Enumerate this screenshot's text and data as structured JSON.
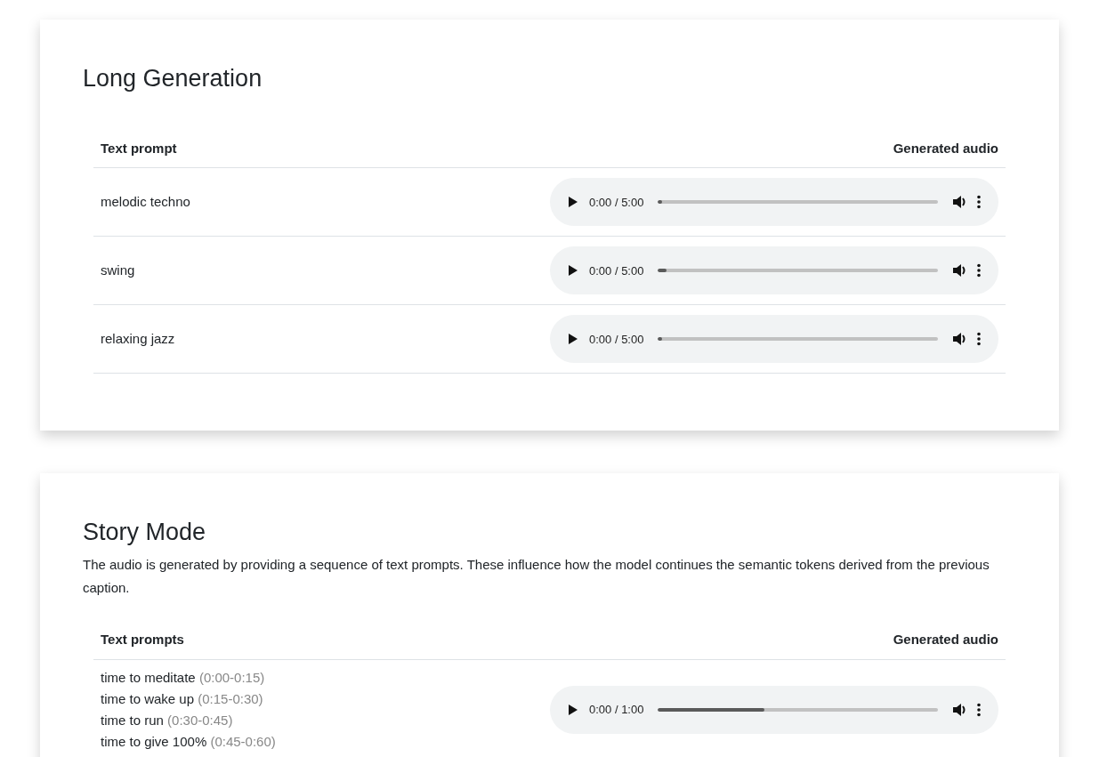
{
  "sections": [
    {
      "title": "Long Generation",
      "columns": [
        "Text prompt",
        "Generated audio"
      ],
      "rows": [
        {
          "prompts": [
            {
              "text": "melodic techno"
            }
          ],
          "audio": {
            "time": "0:00 / 5:00",
            "level": 0.01
          }
        },
        {
          "prompts": [
            {
              "text": "swing"
            }
          ],
          "audio": {
            "time": "0:00 / 5:00",
            "level": 0.03
          }
        },
        {
          "prompts": [
            {
              "text": "relaxing jazz"
            }
          ],
          "audio": {
            "time": "0:00 / 5:00",
            "level": 0.01
          }
        }
      ]
    },
    {
      "title": "Story Mode",
      "description": "The audio is generated by providing a sequence of text prompts. These influence how the model continues the semantic tokens derived from the previous caption.",
      "columns": [
        "Text prompts",
        "Generated audio"
      ],
      "rows": [
        {
          "prompts": [
            {
              "text": "time to meditate",
              "time": "(0:00-0:15)"
            },
            {
              "text": "time to wake up",
              "time": "(0:15-0:30)"
            },
            {
              "text": "time to run",
              "time": "(0:30-0:45)"
            },
            {
              "text": "time to give 100%",
              "time": "(0:45-0:60)"
            }
          ],
          "audio": {
            "time": "0:00 / 1:00",
            "level": 0.38
          }
        }
      ]
    }
  ]
}
